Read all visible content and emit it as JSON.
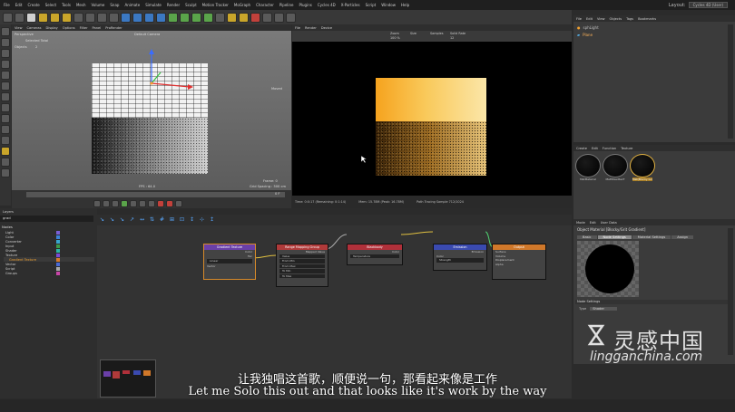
{
  "menubar": {
    "items": [
      "File",
      "Edit",
      "Create",
      "Select",
      "Tools",
      "Mesh",
      "Volume",
      "Snap",
      "Animate",
      "Simulate",
      "Render",
      "Sculpt",
      "Motion Tracker",
      "MoGraph",
      "Character",
      "Pipeline",
      "Plugins",
      "Cycles 4D",
      "X-Particles",
      "Script",
      "Window",
      "Help"
    ],
    "layout_label": "Layout:",
    "layout_value": "Cycles 4D (User)"
  },
  "viewport": {
    "menu": [
      "View",
      "Cameras",
      "Display",
      "Options",
      "Filter",
      "Panel",
      "ProRender"
    ],
    "perspective_label": "Perspective",
    "camera_label": "Default Camera",
    "selected_label": "Selected Total",
    "objects_label": "Objects",
    "objects_value": "2",
    "axis_label": "Moved",
    "frame_label": "Frame: 0",
    "fps_label": "FPS : 64.0",
    "grid_label": "Grid Spacing : 500 cm",
    "frame_counter": "0 F"
  },
  "picture_viewer": {
    "menu": [
      "File",
      "Render",
      "Device"
    ],
    "info_labels": [
      "Zoom",
      "Size",
      "Samples",
      "Solid Rate"
    ],
    "info_values": [
      "100 %",
      "",
      "",
      "12"
    ],
    "status": [
      "Time: 0:0:17 (Remaining: 0:1:14)",
      "Mem: 15.78M (Peak: 16.78M)",
      "Path Tracing Sample 712/1024"
    ]
  },
  "object_manager": {
    "menu": [
      "File",
      "Edit",
      "View",
      "Objects",
      "Tags",
      "Bookmarks"
    ],
    "objects": [
      {
        "name": "sphLight"
      },
      {
        "name": "Plane"
      }
    ]
  },
  "material_manager": {
    "menu": [
      "Create",
      "Edit",
      "Function",
      "Texture"
    ],
    "materials": [
      "MatMaterial",
      "MatMixedtexT",
      "Mat(Blocky Gri"
    ]
  },
  "attribute_manager": {
    "menu": [
      "Mode",
      "Edit",
      "User Data"
    ],
    "title": "Object Material [Blocky/Grit Gradient]",
    "tabs": [
      "Basic",
      "Node Settings",
      "Material Settings",
      "Assign"
    ],
    "section": "Node Settings",
    "type_label": "Type",
    "type_value": "Shader"
  },
  "layers": {
    "title": "Layers",
    "search_value": "grad",
    "header": "Nodes",
    "items": [
      {
        "label": "Light",
        "color": "#7a5fd6",
        "active": false
      },
      {
        "label": "Color",
        "color": "#3a82d8",
        "active": false
      },
      {
        "label": "Converter",
        "color": "#39a6d0",
        "active": false
      },
      {
        "label": "Input",
        "color": "#3b9b4a",
        "active": false
      },
      {
        "label": "Shader",
        "color": "#2ab3a5",
        "active": false
      },
      {
        "label": "Texture",
        "color": "#7a4ad6",
        "active": false
      },
      {
        "label": "Gradient Texture",
        "color": "#d67a2a",
        "active": true
      },
      {
        "label": "Vector",
        "color": "#4a6ad6",
        "active": false
      },
      {
        "label": "Script",
        "color": "#aaaaaa",
        "active": false
      },
      {
        "label": "Groups",
        "color": "#c845a8",
        "active": false
      }
    ]
  },
  "node_editor": {
    "nodes": [
      {
        "title": "Gradient Texture",
        "color": "#6a3fa8",
        "rows": [
          "Color",
          "Fac",
          "Linear",
          "Vector"
        ]
      },
      {
        "title": "Range Mapping Group",
        "color": "#b03a3a",
        "rows": [
          "Mapped Value",
          "Value",
          "From Min",
          "From Max",
          "To Min",
          "To Max"
        ]
      },
      {
        "title": "Blackbody",
        "color": "#b0303a",
        "rows": [
          "Color",
          "Temperature"
        ]
      },
      {
        "title": "Emission",
        "color": "#3a4ab0",
        "rows": [
          "Emission",
          "Color",
          "Strength"
        ]
      },
      {
        "title": "Output",
        "color": "#d0782a",
        "rows": [
          "Surface",
          "Volume",
          "Displacement",
          "Alpha"
        ]
      }
    ]
  },
  "subtitle": {
    "cn": "让我独唱这首歌，顺便说一句，那看起来像是工作",
    "en": "Let me Solo this out and that looks like it's work by the way"
  },
  "watermark": {
    "title": "灵感中国",
    "url": "lingganchina.com"
  }
}
